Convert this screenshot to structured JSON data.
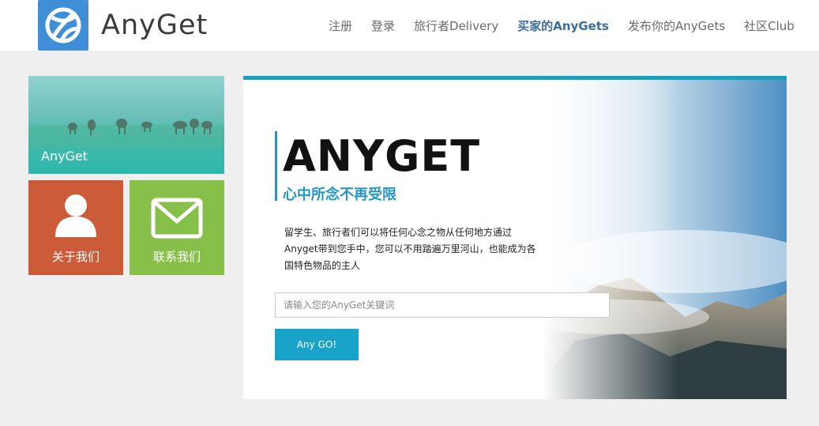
{
  "header": {
    "brand": "AnyGet",
    "logo_icon": "globe-icon",
    "nav": [
      {
        "label": "注册"
      },
      {
        "label": "登录"
      },
      {
        "label": "旅行者Delivery"
      },
      {
        "label": "买家的AnyGets",
        "active": true
      },
      {
        "label": "发布你的AnyGets"
      },
      {
        "label": "社区Club"
      }
    ]
  },
  "tiles": {
    "anyget": {
      "label": "AnyGet"
    },
    "about": {
      "label": "关于我们",
      "icon": "user-icon"
    },
    "contact": {
      "label": "联系我们",
      "icon": "mail-icon"
    }
  },
  "hero": {
    "title": "ANYGET",
    "subtitle": "心中所念不再受限",
    "description": "留学生、旅行者们可以将任何心念之物从任何地方通过Anyget带到您手中，您可以不用踏遍万里河山，也能成为各国特色物品的主人",
    "search_placeholder": "请输入您的AnyGet关键词",
    "button_label": "Any GO!"
  },
  "colors": {
    "accent": "#1aa3c9",
    "nav_active": "#3a6e9b",
    "tile_about": "#cc5b3a",
    "tile_contact": "#86c048",
    "logo": "#3f8fd8"
  }
}
